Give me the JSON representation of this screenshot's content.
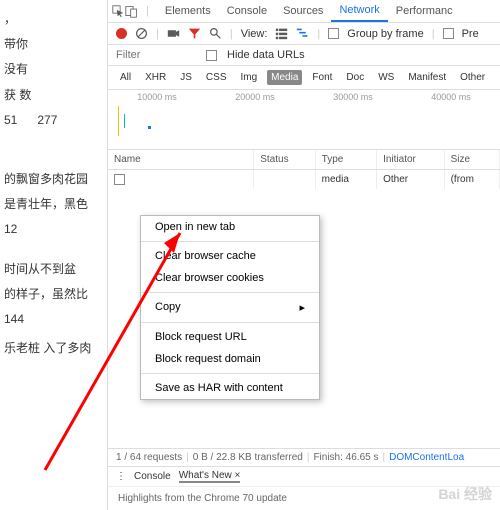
{
  "left": {
    "items": [
      "，",
      "带你",
      "没有",
      "获 数",
      "51",
      "277",
      "的飘窗多肉花园",
      "是青壮年，黑色",
      "12",
      "时间从不到盆",
      "的样子，虽然比",
      "144",
      "乐老桩 入了多肉"
    ]
  },
  "tabs": {
    "elements": "Elements",
    "console": "Console",
    "sources": "Sources",
    "network": "Network",
    "performance": "Performanc"
  },
  "toolbar": {
    "view": "View:",
    "group": "Group by frame",
    "pre": "Pre"
  },
  "filter": {
    "placeholder": "Filter",
    "hide": "Hide data URLs"
  },
  "types": {
    "all": "All",
    "xhr": "XHR",
    "js": "JS",
    "css": "CSS",
    "img": "Img",
    "media": "Media",
    "font": "Font",
    "doc": "Doc",
    "ws": "WS",
    "manifest": "Manifest",
    "other": "Other"
  },
  "timeline": {
    "t1": "10000 ms",
    "t2": "20000 ms",
    "t3": "30000 ms",
    "t4": "40000 ms"
  },
  "table": {
    "head": {
      "name": "Name",
      "status": "Status",
      "type": "Type",
      "init": "Initiator",
      "size": "Size"
    },
    "row0": {
      "type": "media",
      "init": "Other",
      "size": "(from"
    }
  },
  "menu": {
    "open": "Open in new tab",
    "clear_cache": "Clear browser cache",
    "clear_cookies": "Clear browser cookies",
    "copy": "Copy",
    "block_url": "Block request URL",
    "block_domain": "Block request domain",
    "save_har": "Save as HAR with content"
  },
  "status": {
    "req": "1 / 64 requests",
    "bytes": "0 B / 22.8 KB transferred",
    "finish": "Finish: 46.65 s",
    "dom": "DOMContentLoa"
  },
  "drawer": {
    "console": "Console",
    "whats_new": "What's New ×",
    "body": "Highlights from the Chrome 70 update"
  },
  "watermark": "Bai 经验"
}
